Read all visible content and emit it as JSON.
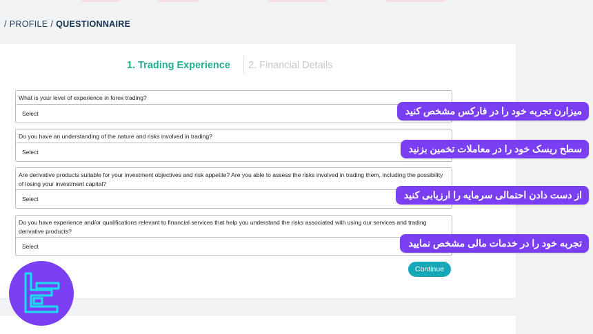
{
  "breadcrumb": {
    "sep1": "/",
    "profile": "PROFILE",
    "sep2": "/",
    "current": "QUESTIONNAIRE"
  },
  "steps": {
    "step1": "1. Trading Experience",
    "step2": "2. Financial Details"
  },
  "questions": [
    {
      "text": "What is your level of experience in forex trading?",
      "select": "Select"
    },
    {
      "text": "Do you have an understanding of the nature and risks involved in trading?",
      "select": "Select"
    },
    {
      "text": "Are derivative products suitable for your investment objectives and risk appetite? Are you able to assess the risks involved in trading them, including the possibility of losing your investment capital?",
      "select": "Select"
    },
    {
      "text": "Do you have experience and/or qualifications relevant to financial services that help you understand the risks associated with using our services and trading derivative products?",
      "select": "Select"
    }
  ],
  "continue_label": "Continue",
  "callouts": [
    "میزارن تجربه خود را در فارکس مشخص کنید",
    "سطح ریسک خود را در معاملات تخمین بزنید",
    "از دست دادن احتمالی سرمایه را ارزیابی کنید",
    "تجربه خود را در خدمات مالی مشخص نمایید"
  ],
  "colors": {
    "accent_green": "#1fae8f",
    "continue_teal": "#17a8b8",
    "callout_purple": "#7a3ff2",
    "logo_cyan": "#20d6f0"
  },
  "logo_icon": "tradingfinder-logo-icon"
}
